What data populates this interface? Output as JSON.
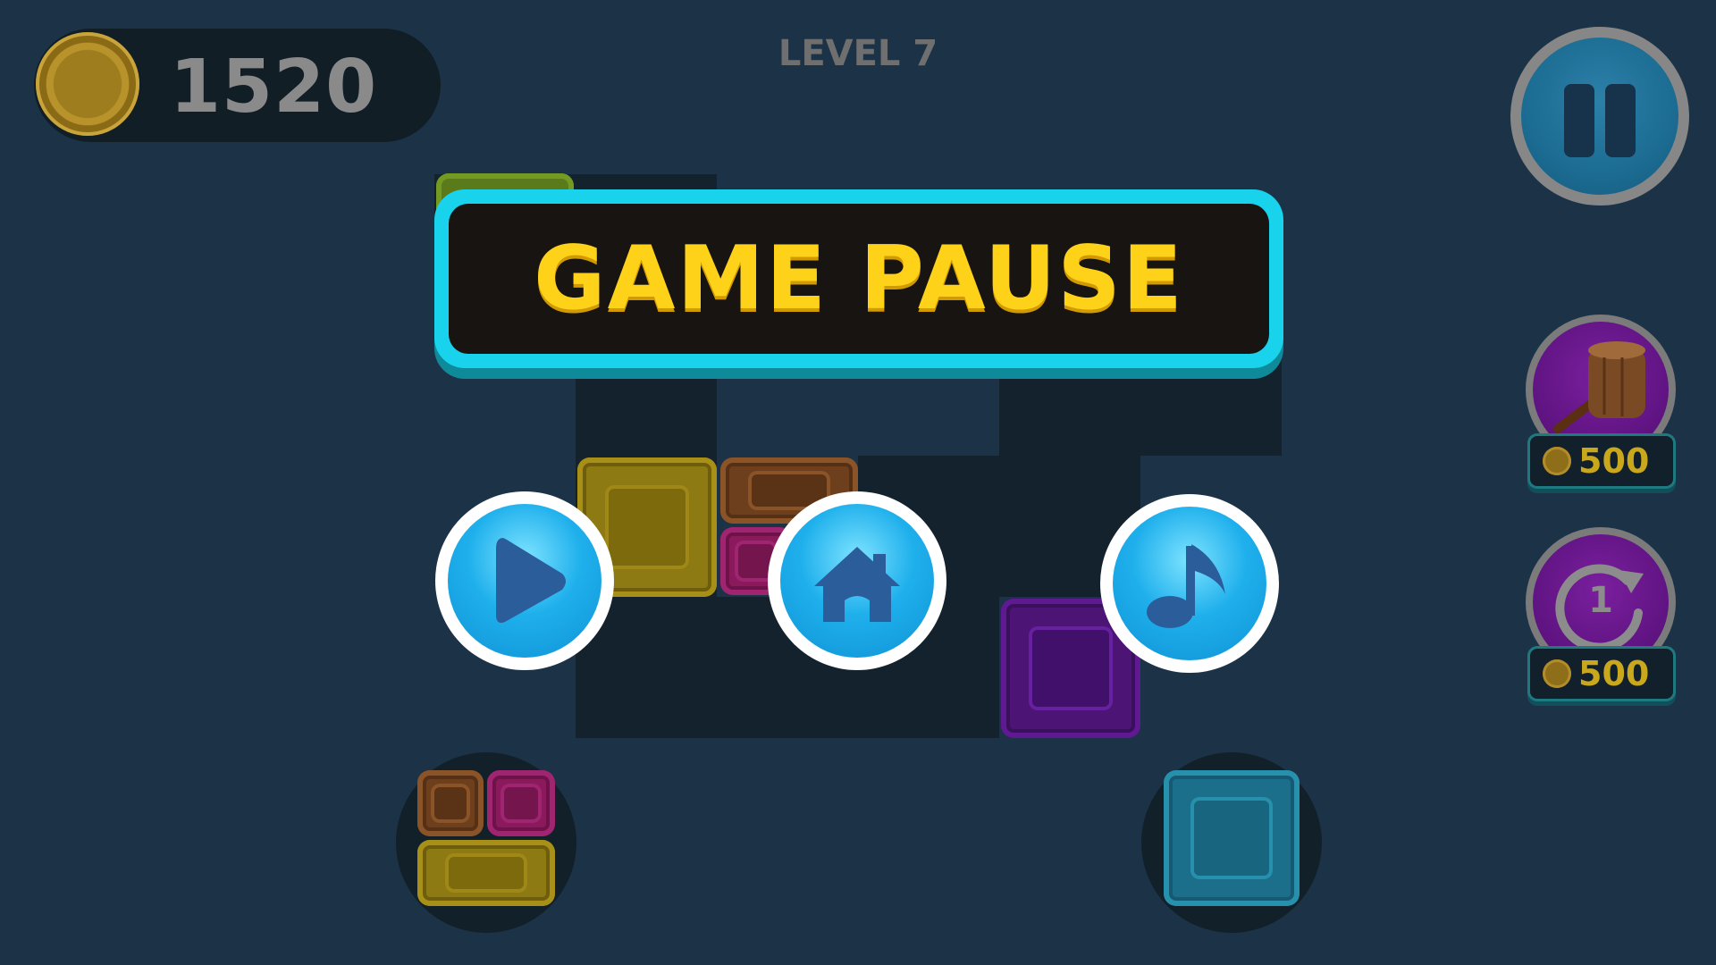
{
  "hud": {
    "coins": "1520",
    "level": "LEVEL 7",
    "pause_icon": "pause-icon"
  },
  "pause_menu": {
    "title": "GAME PAUSE",
    "buttons": [
      {
        "icon": "play-icon"
      },
      {
        "icon": "home-icon"
      },
      {
        "icon": "music-note-icon"
      }
    ]
  },
  "powerups": [
    {
      "icon": "mallet-icon",
      "price": "500"
    },
    {
      "icon": "undo-one-icon",
      "label": "1",
      "price": "500"
    }
  ],
  "colors": {
    "background": "#1c3347",
    "banner_border": "#19d2ec",
    "title_text": "#ffd21a",
    "menu_button": "#1fb0ec",
    "powerup": "#5e1380"
  },
  "blocks": [
    "green",
    "yellow",
    "brown",
    "pink",
    "purple",
    "cyan"
  ]
}
